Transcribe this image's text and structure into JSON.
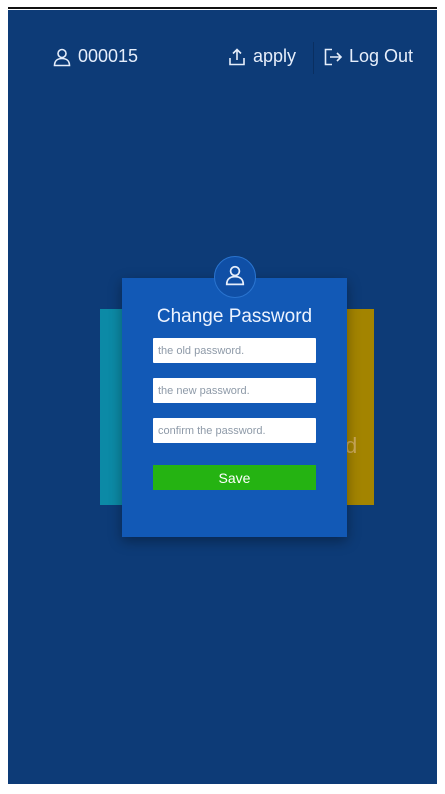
{
  "header": {
    "user_id": "000015",
    "apply_label": "apply",
    "logout_label": "Log Out"
  },
  "background_card": {
    "partial_text": "d"
  },
  "modal": {
    "title": "Change Password",
    "old_password_placeholder": "the old password.",
    "new_password_placeholder": "the new password.",
    "confirm_password_placeholder": "confirm the password.",
    "save_label": "Save"
  },
  "colors": {
    "background": "#0d3b77",
    "modal": "#1259b6",
    "save_button": "#25b312",
    "left_card": "#0c8aa6",
    "right_card": "#a38400"
  },
  "icons": {
    "user": "user-icon",
    "apply": "upload-icon",
    "logout": "logout-icon",
    "avatar": "user-icon"
  }
}
